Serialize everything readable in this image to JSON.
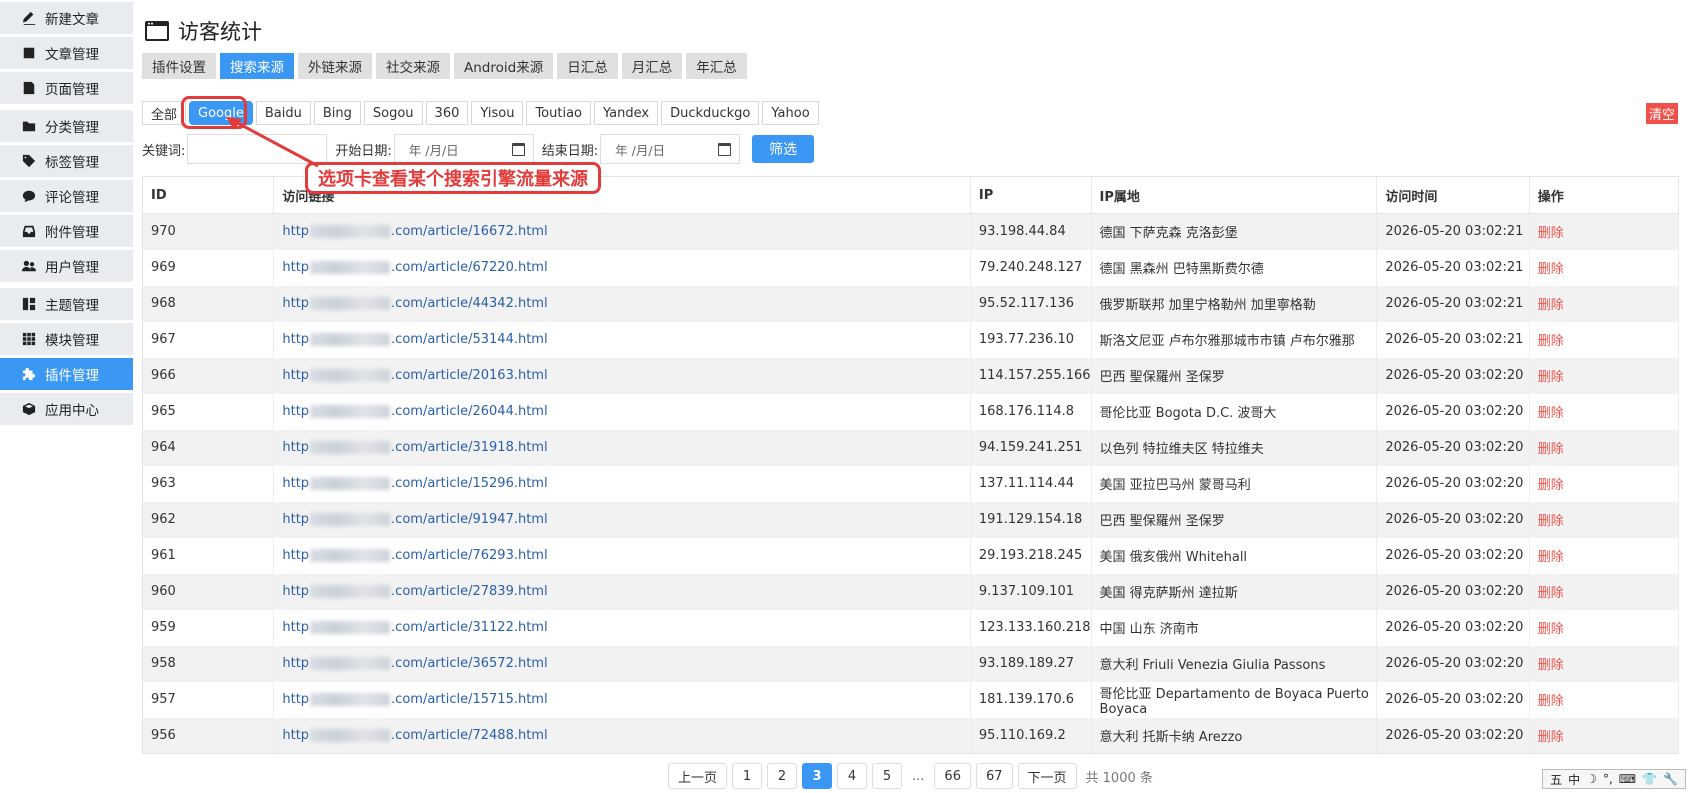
{
  "sidebar": {
    "items": [
      {
        "label": "新建文章",
        "icon": "edit-icon"
      },
      {
        "label": "文章管理",
        "icon": "article-icon"
      },
      {
        "label": "页面管理",
        "icon": "page-icon"
      },
      {
        "label": "分类管理",
        "icon": "folder-icon"
      },
      {
        "label": "标签管理",
        "icon": "tag-icon"
      },
      {
        "label": "评论管理",
        "icon": "comment-icon"
      },
      {
        "label": "附件管理",
        "icon": "inbox-icon"
      },
      {
        "label": "用户管理",
        "icon": "users-icon"
      },
      {
        "label": "主题管理",
        "icon": "theme-icon"
      },
      {
        "label": "模块管理",
        "icon": "grid-icon"
      },
      {
        "label": "插件管理",
        "icon": "puzzle-icon"
      },
      {
        "label": "应用中心",
        "icon": "cube-icon"
      }
    ]
  },
  "header": {
    "title": "访客统计",
    "icon": "window-icon"
  },
  "tabs": [
    "插件设置",
    "搜索来源",
    "外链来源",
    "社交来源",
    "Android来源",
    "日汇总",
    "月汇总",
    "年汇总"
  ],
  "engines": [
    "全部",
    "Google",
    "Baidu",
    "Bing",
    "Sogou",
    "360",
    "Yisou",
    "Toutiao",
    "Yandex",
    "Duckduckgo",
    "Yahoo"
  ],
  "clear_label": "清空",
  "filters": {
    "keyword_label": "关键词:",
    "start_label": "开始日期:",
    "end_label": "结束日期:",
    "date_placeholder": "年 /月/日",
    "filter_button": "筛选"
  },
  "annotation": "选项卡查看某个搜索引擎流量来源",
  "table": {
    "headers": [
      "ID",
      "访问链接",
      "IP",
      "IP属地",
      "访问时间",
      "操作"
    ],
    "link_prefix": "http",
    "delete_label": "删除",
    "rows": [
      {
        "id": "970",
        "link": ".com/article/16672.html",
        "ip": "93.198.44.84",
        "loc": "德国 下萨克森 克洛彭堡",
        "time": "2026-05-20 03:02:21"
      },
      {
        "id": "969",
        "link": ".com/article/67220.html",
        "ip": "79.240.248.127",
        "loc": "德国 黑森州 巴特黑斯费尔德",
        "time": "2026-05-20 03:02:21"
      },
      {
        "id": "968",
        "link": ".com/article/44342.html",
        "ip": "95.52.117.136",
        "loc": "俄罗斯联邦 加里宁格勒州 加里寧格勒",
        "time": "2026-05-20 03:02:21"
      },
      {
        "id": "967",
        "link": ".com/article/53144.html",
        "ip": "193.77.236.10",
        "loc": "斯洛文尼亚 卢布尔雅那城市市镇 卢布尔雅那",
        "time": "2026-05-20 03:02:21"
      },
      {
        "id": "966",
        "link": ".com/article/20163.html",
        "ip": "114.157.255.166",
        "loc": "巴西 聖保羅州 圣保罗",
        "time": "2026-05-20 03:02:20"
      },
      {
        "id": "965",
        "link": ".com/article/26044.html",
        "ip": "168.176.114.8",
        "loc": "哥伦比亚 Bogota D.C. 波哥大",
        "time": "2026-05-20 03:02:20"
      },
      {
        "id": "964",
        "link": ".com/article/31918.html",
        "ip": "94.159.241.251",
        "loc": "以色列 特拉维夫区 特拉维夫",
        "time": "2026-05-20 03:02:20"
      },
      {
        "id": "963",
        "link": ".com/article/15296.html",
        "ip": "137.11.114.44",
        "loc": "美国 亚拉巴马州 蒙哥马利",
        "time": "2026-05-20 03:02:20"
      },
      {
        "id": "962",
        "link": ".com/article/91947.html",
        "ip": "191.129.154.18",
        "loc": "巴西 聖保羅州 圣保罗",
        "time": "2026-05-20 03:02:20"
      },
      {
        "id": "961",
        "link": ".com/article/76293.html",
        "ip": "29.193.218.245",
        "loc": "美国 俄亥俄州 Whitehall",
        "time": "2026-05-20 03:02:20"
      },
      {
        "id": "960",
        "link": ".com/article/27839.html",
        "ip": "9.137.109.101",
        "loc": "美国 得克萨斯州 達拉斯",
        "time": "2026-05-20 03:02:20"
      },
      {
        "id": "959",
        "link": ".com/article/31122.html",
        "ip": "123.133.160.218",
        "loc": "中国 山东 济南市",
        "time": "2026-05-20 03:02:20"
      },
      {
        "id": "958",
        "link": ".com/article/36572.html",
        "ip": "93.189.189.27",
        "loc": "意大利 Friuli Venezia Giulia Passons",
        "time": "2026-05-20 03:02:20"
      },
      {
        "id": "957",
        "link": ".com/article/15715.html",
        "ip": "181.139.170.6",
        "loc": "哥伦比亚 Departamento de Boyaca Puerto Boyaca",
        "time": "2026-05-20 03:02:20"
      },
      {
        "id": "956",
        "link": ".com/article/72488.html",
        "ip": "95.110.169.2",
        "loc": "意大利 托斯卡纳 Arezzo",
        "time": "2026-05-20 03:02:20"
      }
    ]
  },
  "pagination": {
    "prev": "上一页",
    "pages": [
      "1",
      "2",
      "3",
      "4",
      "5"
    ],
    "current": "3",
    "dots": "...",
    "tail_pages": [
      "66",
      "67"
    ],
    "next": "下一页",
    "total": "共 1000 条"
  },
  "ime": [
    "五",
    "中",
    "☽",
    "°,",
    "⌨",
    "👕",
    "🔧"
  ],
  "colors": {
    "accent": "#3a97f3",
    "danger": "#f0504a",
    "annotation": "#e33b3b",
    "link": "#2a5fa8"
  }
}
